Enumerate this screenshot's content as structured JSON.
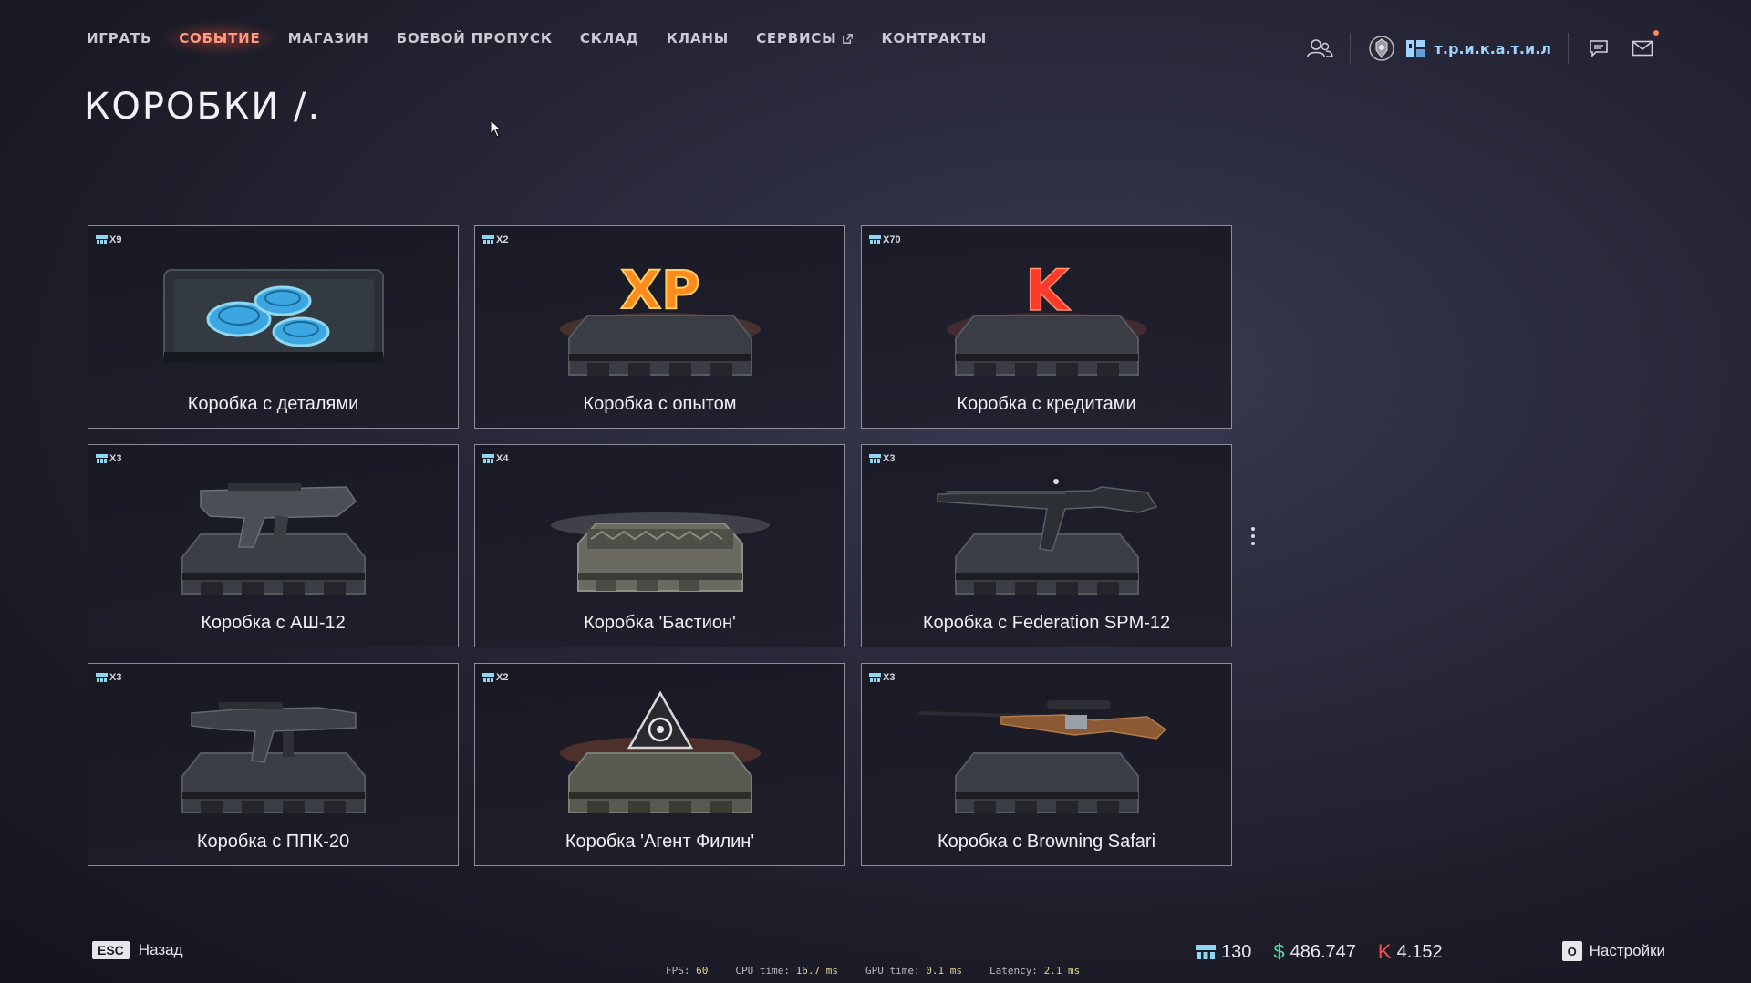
{
  "nav": {
    "items": [
      {
        "label": "ИГРАТЬ"
      },
      {
        "label": "СОБЫТИЕ"
      },
      {
        "label": "МАГАЗИН"
      },
      {
        "label": "БОЕВОЙ ПРОПУСК"
      },
      {
        "label": "СКЛАД"
      },
      {
        "label": "КЛАНЫ"
      },
      {
        "label": "СЕРВИСЫ"
      },
      {
        "label": "КОНТРАКТЫ"
      }
    ],
    "active_index": 1
  },
  "profile": {
    "nickname": "т.р.и.к.а.т.и.л"
  },
  "page": {
    "title": "КОРОБКИ /."
  },
  "cards": [
    {
      "count": "X9",
      "label": "Коробка с деталями",
      "art": "parts-coins"
    },
    {
      "count": "X2",
      "label": "Коробка с опытом",
      "art": "xp"
    },
    {
      "count": "X70",
      "label": "Коробка с кредитами",
      "art": "credits-k"
    },
    {
      "count": "X3",
      "label": "Коробка с АШ-12",
      "art": "rifle-ash12"
    },
    {
      "count": "X4",
      "label": "Коробка 'Бастион'",
      "art": "bastion-crate"
    },
    {
      "count": "X3",
      "label": "Коробка с Federation SPM-12",
      "art": "shotgun-spm12"
    },
    {
      "count": "X3",
      "label": "Коробка с ППК-20",
      "art": "smg-ppk20"
    },
    {
      "count": "X2",
      "label": "Коробка 'Агент Филин'",
      "art": "agent-filin"
    },
    {
      "count": "X3",
      "label": "Коробка с Browning Safari",
      "art": "rifle-browning"
    }
  ],
  "footer": {
    "esc_key": "ESC",
    "back_label": "Назад",
    "perf": {
      "fps_label": "FPS:",
      "fps": "60",
      "cpu_label": "CPU time:",
      "cpu": "16.7 ms",
      "gpu_label": "GPU time:",
      "gpu": "0.1 ms",
      "latency_label": "Latency:",
      "latency": "2.1 ms"
    },
    "currencies": {
      "crates": "130",
      "money_symbol": "$",
      "money": "486.747",
      "credits_symbol": "K",
      "credits": "4.152"
    },
    "settings_key": "O",
    "settings_label": "Настройки"
  },
  "colors": {
    "accent_active": "#ff9980",
    "money": "#4fd6a0",
    "credits": "#ff4a4a",
    "crates": "#8fd6f0"
  }
}
